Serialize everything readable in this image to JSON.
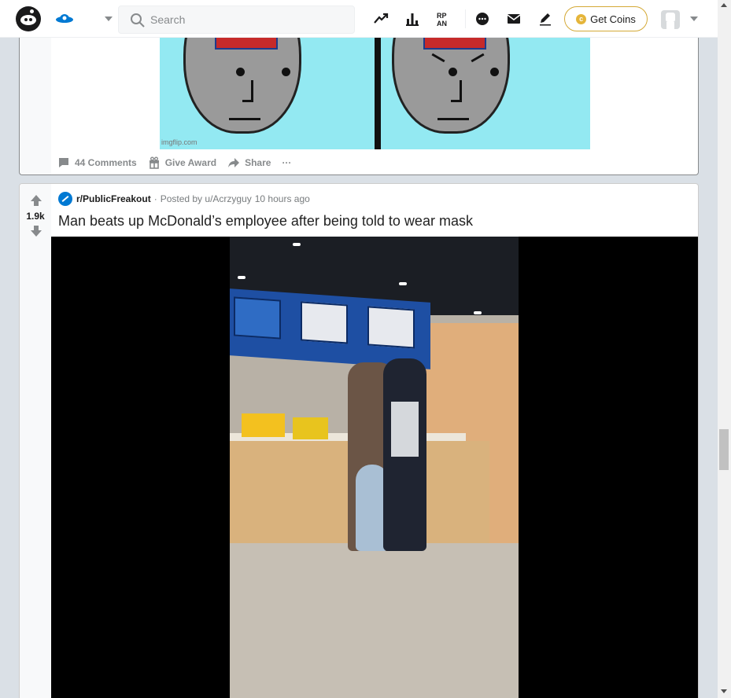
{
  "header": {
    "search_placeholder": "Search",
    "get_coins_label": "Get Coins",
    "coin_symbol": "c",
    "icons": [
      "trending-icon",
      "stats-icon",
      "rpan-icon",
      "chat-icon",
      "mail-icon",
      "create-post-icon"
    ],
    "accent_color": "#0079d3",
    "coin_border_color": "#d4a936"
  },
  "post1": {
    "image_watermark": "imgflip.com",
    "actions": {
      "comments_label": "44 Comments",
      "award_label": "Give Award",
      "share_label": "Share",
      "more_label": "···"
    }
  },
  "post2": {
    "vote_count": "1.9k",
    "subreddit": "r/PublicFreakout",
    "separator": "·",
    "posted_by": "Posted by u/Acrzyguy",
    "time_ago": "10 hours ago",
    "title": "Man beats up McDonald’s employee after being told to wear mask"
  }
}
